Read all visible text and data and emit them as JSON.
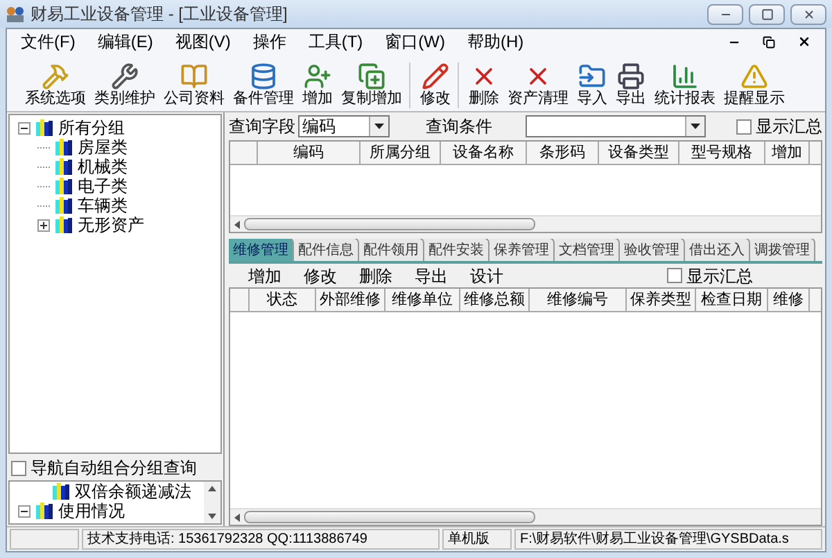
{
  "window": {
    "title": "财易工业设备管理 - [工业设备管理]"
  },
  "menu": [
    "文件(F)",
    "编辑(E)",
    "视图(V)",
    "操作",
    "工具(T)",
    "窗口(W)",
    "帮助(H)"
  ],
  "toolbar": [
    [
      "系统选项",
      "类别维护",
      "公司资料",
      "备件管理",
      "增加",
      "复制增加"
    ],
    [
      "修改"
    ],
    [
      "删除",
      "资产清理",
      "导入",
      "导出",
      "统计报表",
      "提醒显示"
    ]
  ],
  "tree": [
    {
      "label": "所有分组",
      "expanded": true,
      "children": [
        {
          "label": "房屋类"
        },
        {
          "label": "机械类"
        },
        {
          "label": "电子类"
        },
        {
          "label": "车辆类"
        },
        {
          "label": "无形资产",
          "expanded": false
        }
      ]
    }
  ],
  "nav_checkbox": {
    "label": "导航自动组合分组查询",
    "checked": false
  },
  "lower_tree": [
    {
      "kind": "leaf",
      "label": "双倍余额递减法"
    },
    {
      "kind": "branch",
      "label": "使用情况",
      "expanded": true
    }
  ],
  "query": {
    "field_label": "查询字段",
    "field_value": "编码",
    "condition_label": "查询条件",
    "summary": {
      "label": "显示汇总",
      "checked": false
    }
  },
  "table": {
    "columns": [
      "编码",
      "所属分组",
      "设备名称",
      "条形码",
      "设备类型",
      "型号规格",
      "增加"
    ]
  },
  "tabs": [
    {
      "label": "维修管理",
      "selected": true
    },
    {
      "label": "配件信息",
      "selected": false
    },
    {
      "label": "配件领用",
      "selected": false
    },
    {
      "label": "配件安装",
      "selected": false
    },
    {
      "label": "保养管理",
      "selected": false
    },
    {
      "label": "文档管理",
      "selected": false
    },
    {
      "label": "验收管理",
      "selected": false
    },
    {
      "label": "借出还入",
      "selected": false
    },
    {
      "label": "调拨管理",
      "selected": false
    }
  ],
  "sub_toolbar": {
    "buttons": [
      "增加",
      "修改",
      "删除",
      "导出",
      "设计"
    ],
    "summary": {
      "label": "显示汇总",
      "checked": false
    }
  },
  "detail_table": {
    "columns": [
      "状态",
      "外部维修",
      "维修单位",
      "维修总额",
      "维修编号",
      "保养类型",
      "检查日期",
      "维修"
    ]
  },
  "status_bar": [
    "技术支持电话: 15361792328 QQ:1113886749",
    "单机版",
    "F:\\财易软件\\财易工业设备管理\\GYSBData.s"
  ]
}
